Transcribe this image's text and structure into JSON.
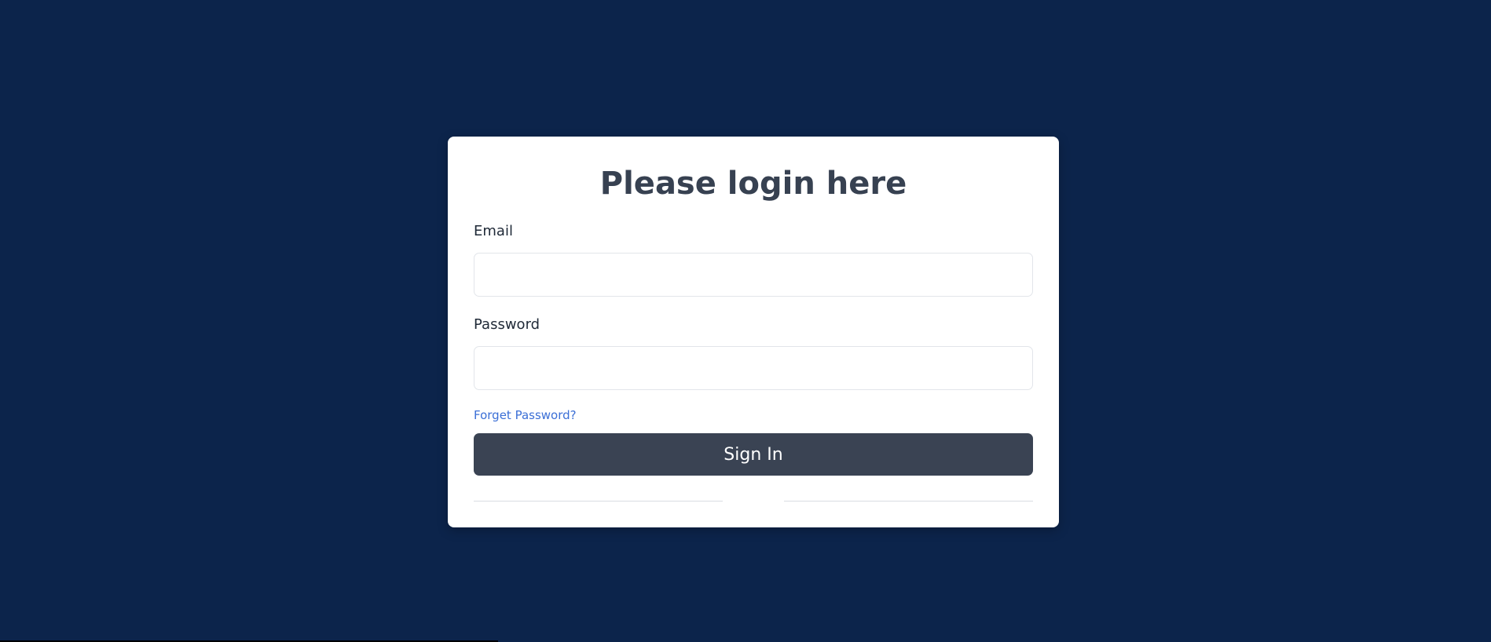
{
  "login": {
    "title": "Please login here",
    "email_label": "Email",
    "email_value": "",
    "password_label": "Password",
    "password_value": "",
    "forgot_password": "Forget Password?",
    "sign_in": "Sign In"
  },
  "colors": {
    "background": "#0c244b",
    "card": "#ffffff",
    "button": "#3a4353",
    "link": "#3b6fd6",
    "title": "#374151"
  }
}
